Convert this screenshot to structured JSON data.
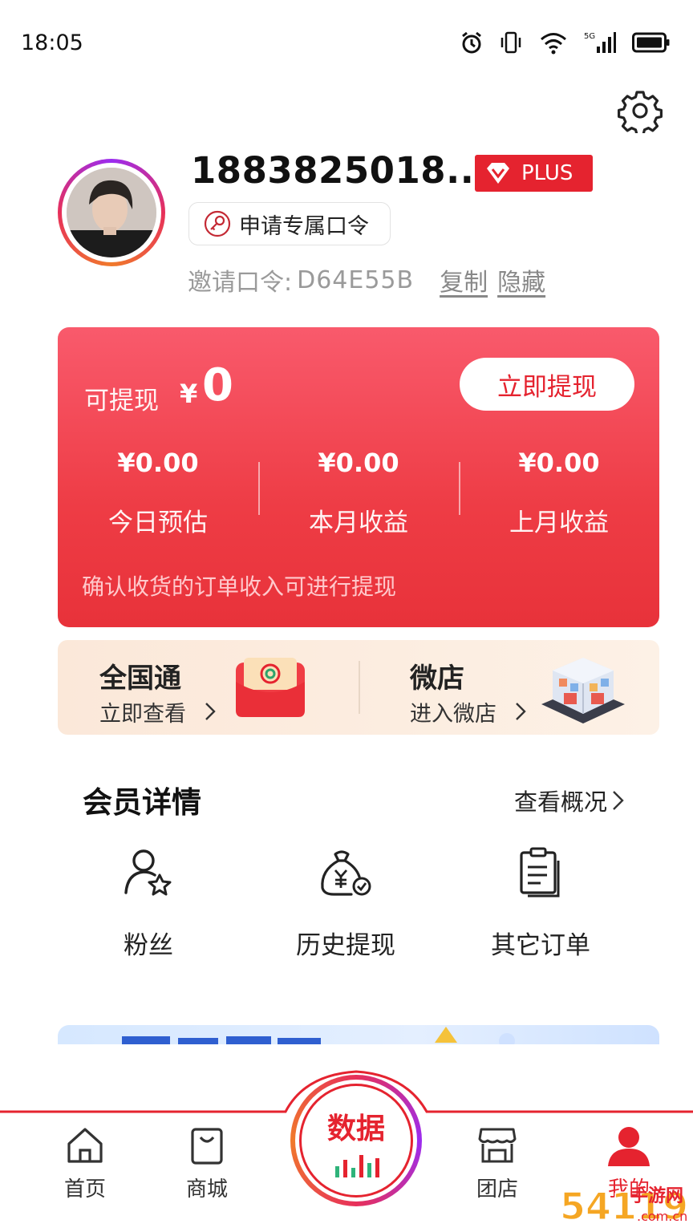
{
  "status_bar": {
    "time": "18:05",
    "network": "5G",
    "icons": [
      "alarm-icon",
      "vibrate-icon",
      "wifi-icon",
      "signal-icon",
      "battery-icon"
    ]
  },
  "header": {
    "settings_icon": "gear-icon"
  },
  "profile": {
    "username": "1883825018...",
    "badge": "PLUS",
    "apply_button": "申请专属口令",
    "invite_label": "邀请口令:",
    "invite_code": "D64E55B",
    "copy": "复制",
    "hide": "隐藏"
  },
  "wallet": {
    "label": "可提现",
    "currency": "¥",
    "amount": "0",
    "withdraw_button": "立即提现",
    "stats": [
      {
        "value": "¥0.00",
        "label": "今日预估"
      },
      {
        "value": "¥0.00",
        "label": "本月收益"
      },
      {
        "value": "¥0.00",
        "label": "上月收益"
      }
    ],
    "note": "确认收货的订单收入可进行提现"
  },
  "promos": [
    {
      "title": "全国通",
      "subtitle": "立即查看"
    },
    {
      "title": "微店",
      "subtitle": "进入微店"
    }
  ],
  "member": {
    "title": "会员详情",
    "more": "查看概况",
    "items": [
      {
        "label": "粉丝",
        "icon": "fans-icon"
      },
      {
        "label": "历史提现",
        "icon": "money-bag-icon"
      },
      {
        "label": "其它订单",
        "icon": "clipboard-icon"
      }
    ]
  },
  "tabbar": {
    "tabs": [
      {
        "label": "首页",
        "icon": "home-icon"
      },
      {
        "label": "商城",
        "icon": "shopping-bag-icon"
      },
      {
        "label": "数据",
        "icon": "chart-icon"
      },
      {
        "label": "团店",
        "icon": "store-icon"
      },
      {
        "label": "我的",
        "icon": "user-icon"
      }
    ],
    "active_index": 4
  },
  "watermark": {
    "text": "手游网",
    "domain": ".com.cn",
    "number": "54119"
  },
  "colors": {
    "primary": "#e5232f",
    "card_gradient_top": "#f95a6c",
    "promo_bg": "#fbe8d9"
  }
}
